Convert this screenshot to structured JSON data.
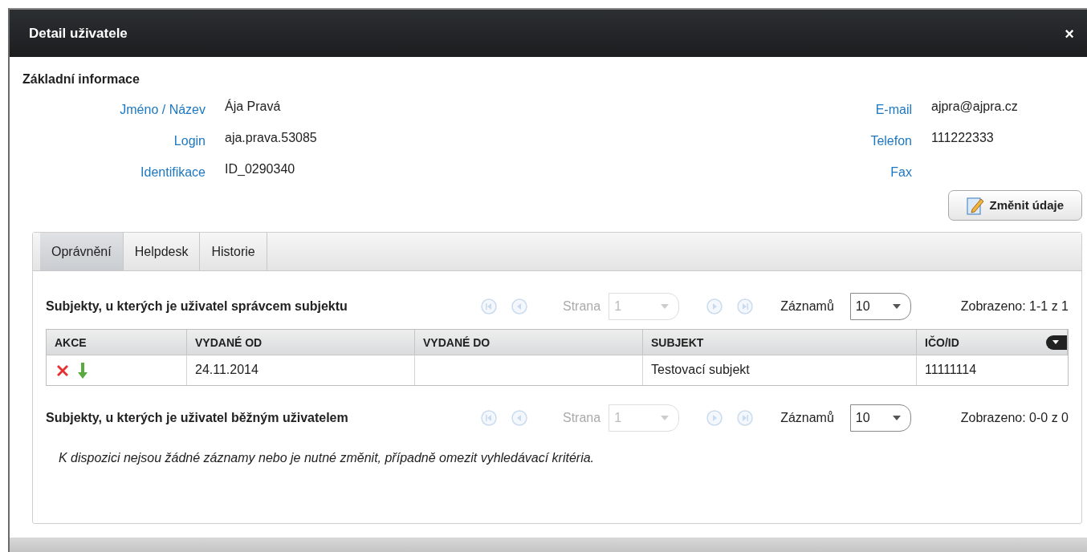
{
  "window": {
    "title": "Detail uživatele",
    "close": "×"
  },
  "basic_info": {
    "title": "Základní informace",
    "left_fields": [
      {
        "label": "Jméno / Název",
        "value": "Ája Pravá"
      },
      {
        "label": "Login",
        "value": "aja.prava.53085"
      },
      {
        "label": "Identifikace",
        "value": "ID_0290340"
      }
    ],
    "right_fields": [
      {
        "label": "E-mail",
        "value": "ajpra@ajpra.cz"
      },
      {
        "label": "Telefon",
        "value": "111222333"
      },
      {
        "label": "Fax"
      }
    ]
  },
  "edit_button": {
    "label": "Změnit údaje"
  },
  "tabs": [
    {
      "label": "Oprávnění",
      "selected": true
    },
    {
      "label": "Helpdesk",
      "selected": false
    },
    {
      "label": "Historie",
      "selected": false
    }
  ],
  "sections": [
    {
      "title": "Subjekty, u kterých je uživatel správcem subjektu",
      "pager": {
        "nav_disabled": true,
        "page_label": "Strana",
        "page": "1",
        "page_disabled": true,
        "records_label": "Záznamů",
        "records": "10",
        "summary": "Zobrazeno: 1-1 z 1"
      },
      "table": {
        "columns": [
          "AKCE",
          "VYDANÉ OD",
          "VYDANÉ DO",
          "SUBJEKT",
          "IČO/ID"
        ],
        "rows": [
          {
            "actions": [
              {
                "kind": "delete"
              },
              {
                "kind": "move-down"
              }
            ],
            "cells": [
              "",
              "24.11.2014",
              "",
              "Testovací subjekt",
              "11111114"
            ]
          }
        ]
      }
    },
    {
      "title": "Subjekty, u kterých je uživatel běžným uživatelem",
      "pager": {
        "nav_disabled": true,
        "page_label": "Strana",
        "page": "1",
        "page_disabled": true,
        "records_label": "Záznamů",
        "records": "10",
        "summary": "Zobrazeno: 0-0 z 0"
      },
      "empty_message": "K dispozici nejsou žádné záznamy nebo je nutné změnit, případně omezit vyhledávací kritéria."
    }
  ]
}
